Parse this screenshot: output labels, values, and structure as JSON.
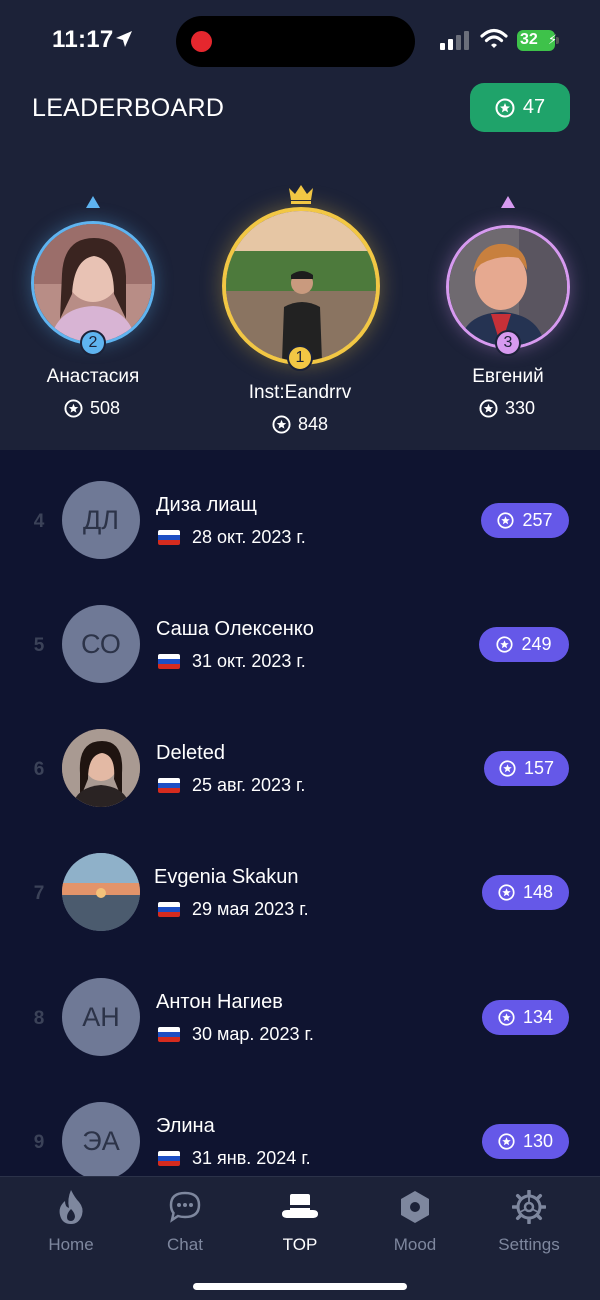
{
  "status_bar": {
    "time": "11:17",
    "battery": "32"
  },
  "header": {
    "title": "LEADERBOARD",
    "balance": "47"
  },
  "podium": [
    {
      "rank": "2",
      "name": "Анастасия",
      "score": "508",
      "color": "#5fb4f0"
    },
    {
      "rank": "1",
      "name": "Inst:Eandrrv",
      "score": "848",
      "color": "#f2c744"
    },
    {
      "rank": "3",
      "name": "Евгений",
      "score": "330",
      "color": "#d79af0"
    }
  ],
  "list": [
    {
      "rank": "4",
      "initials": "ДЛ",
      "name": "Диза лиащ",
      "date": "28 окт. 2023 г.",
      "score": "257"
    },
    {
      "rank": "5",
      "initials": "СО",
      "name": "Саша Олексенко",
      "date": "31 окт. 2023 г.",
      "score": "249"
    },
    {
      "rank": "6",
      "initials": "",
      "name": "Deleted",
      "date": "25 авг. 2023 г.",
      "score": "157"
    },
    {
      "rank": "7",
      "initials": "",
      "name": "Evgenia Skakun",
      "date": "29 мая 2023 г.",
      "score": "148"
    },
    {
      "rank": "8",
      "initials": "АН",
      "name": "Антон Нагиев",
      "date": "30 мар. 2023 г.",
      "score": "134"
    },
    {
      "rank": "9",
      "initials": "ЭА",
      "name": "Элина",
      "date": "31 янв. 2024 г.",
      "score": "130"
    }
  ],
  "tabs": [
    {
      "label": "Home",
      "icon": "flame-icon"
    },
    {
      "label": "Chat",
      "icon": "chat-bubble-icon"
    },
    {
      "label": "TOP",
      "icon": "top-hat-icon"
    },
    {
      "label": "Mood",
      "icon": "hexagon-icon"
    },
    {
      "label": "Settings",
      "icon": "gear-icon"
    }
  ],
  "colors": {
    "accent": "#6558e8",
    "balance": "#1fa36a",
    "background": "#0f1430",
    "panel": "#1c2238"
  }
}
